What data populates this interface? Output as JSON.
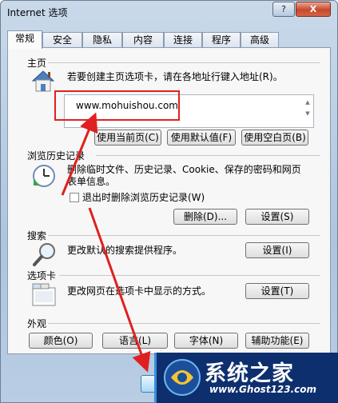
{
  "window": {
    "title": "Internet 选项",
    "help_label": "?",
    "close_label": "X"
  },
  "tabs": [
    "常规",
    "安全",
    "隐私",
    "内容",
    "连接",
    "程序",
    "高级"
  ],
  "home": {
    "title": "主页",
    "desc": "若要创建主页选项卡，请在各地址行键入地址(R)。",
    "address": "www.mohuishou.com",
    "buttons": [
      "使用当前页(C)",
      "使用默认值(F)",
      "使用空白页(B)"
    ]
  },
  "history": {
    "title": "浏览历史记录",
    "desc_line1": "删除临时文件、历史记录、Cookie、保存的密码和网页",
    "desc_line2": "表单信息。",
    "checkbox_label": "退出时删除浏览历史记录(W)",
    "checkbox_checked": false,
    "delete_label": "删除(D)...",
    "settings_label": "设置(S)"
  },
  "search": {
    "title": "搜索",
    "desc": "更改默认的搜索提供程序。",
    "settings_label": "设置(I)"
  },
  "tabs_section": {
    "title": "选项卡",
    "desc": "更改网页在选项卡中显示的方式。",
    "settings_label": "设置(T)"
  },
  "appearance": {
    "title": "外观",
    "buttons": [
      "颜色(O)",
      "语言(L)",
      "字体(N)",
      "辅助功能(E)"
    ]
  },
  "watermark": {
    "title": "系统之家",
    "url": "www.Ghost123.com"
  },
  "colors": {
    "annotation": "#e02020",
    "watermark_bg": "#0d2f6e"
  }
}
